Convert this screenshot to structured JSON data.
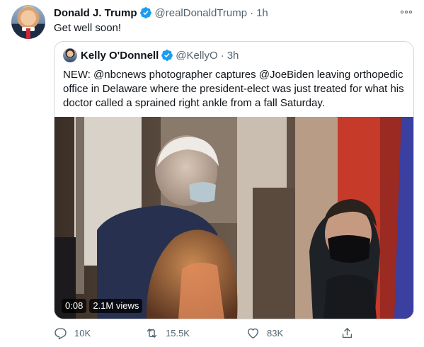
{
  "tweet": {
    "author_name": "Donald J. Trump",
    "handle": "@realDonaldTrump",
    "separator": "·",
    "time": "1h",
    "text": "Get well soon!"
  },
  "quoted_tweet": {
    "author_name": "Kelly O'Donnell",
    "handle": "@KellyO",
    "separator": "·",
    "time": "3h",
    "text": "NEW:  @nbcnews photographer captures @JoeBiden leaving orthopedic office in Delaware where the president-elect was just treated for what his doctor called a sprained right ankle from a fall Saturday.",
    "video": {
      "duration": "0:08",
      "views": "2.1M views"
    }
  },
  "actions": {
    "reply_count": "10K",
    "retweet_count": "15.5K",
    "like_count": "83K"
  },
  "icons": {
    "verified": "verified-badge-icon",
    "more": "more-options-icon",
    "reply": "reply-icon",
    "retweet": "retweet-icon",
    "like": "heart-icon",
    "share": "share-icon"
  },
  "colors": {
    "verified": "#1d9bf0",
    "secondary_text": "#536471",
    "border": "#cfd9de"
  }
}
